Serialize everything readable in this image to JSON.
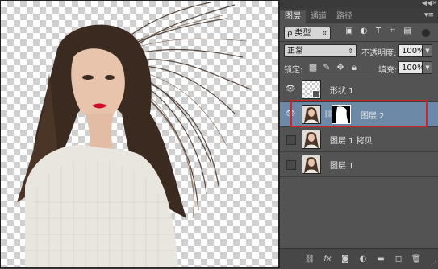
{
  "panel": {
    "tabs": [
      "图层",
      "通道",
      "路径"
    ],
    "filter": {
      "kind_label": "ρ 类型"
    },
    "blend_mode": "正常",
    "opacity_label": "不透明度:",
    "opacity_value": "100%",
    "lock_label": "锁定:",
    "fill_label": "填充:",
    "fill_value": "100%",
    "layers": [
      {
        "name": "形状 1",
        "visible": true,
        "selected": false
      },
      {
        "name": "图层 2",
        "visible": true,
        "selected": true
      },
      {
        "name": "图层 1 拷贝",
        "visible": false,
        "selected": false
      },
      {
        "name": "图层 1",
        "visible": false,
        "selected": false
      }
    ],
    "bottom_icons": [
      "link-layers-icon",
      "fx-icon",
      "add-mask-icon",
      "adjustment-layer-icon",
      "new-group-icon",
      "new-layer-icon",
      "delete-layer-icon"
    ]
  },
  "colors": {
    "panel_bg": "#535353",
    "selected_layer": "#6d89a8",
    "highlight_border": "#d2232a"
  }
}
